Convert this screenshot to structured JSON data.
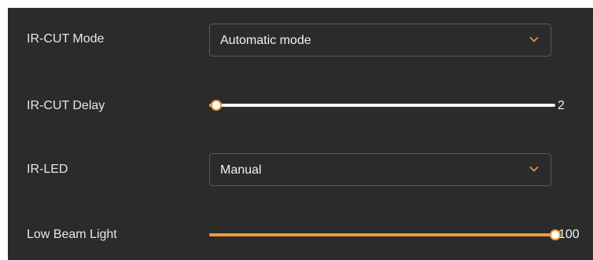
{
  "ir_cut_mode": {
    "label": "IR-CUT Mode",
    "value": "Automatic mode",
    "chevron_icon": "chevron-down-icon"
  },
  "ir_cut_delay": {
    "label": "IR-CUT Delay",
    "value": "2",
    "fraction": 0.02
  },
  "ir_led": {
    "label": "IR-LED",
    "value": "Manual",
    "chevron_icon": "chevron-down-icon"
  },
  "low_beam_light": {
    "label": "Low Beam Light",
    "value": "100",
    "fraction": 1.0
  },
  "colors": {
    "accent": "#ef9a3c",
    "panel_background": "#2b2b2b",
    "text": "#e6e6e6"
  }
}
